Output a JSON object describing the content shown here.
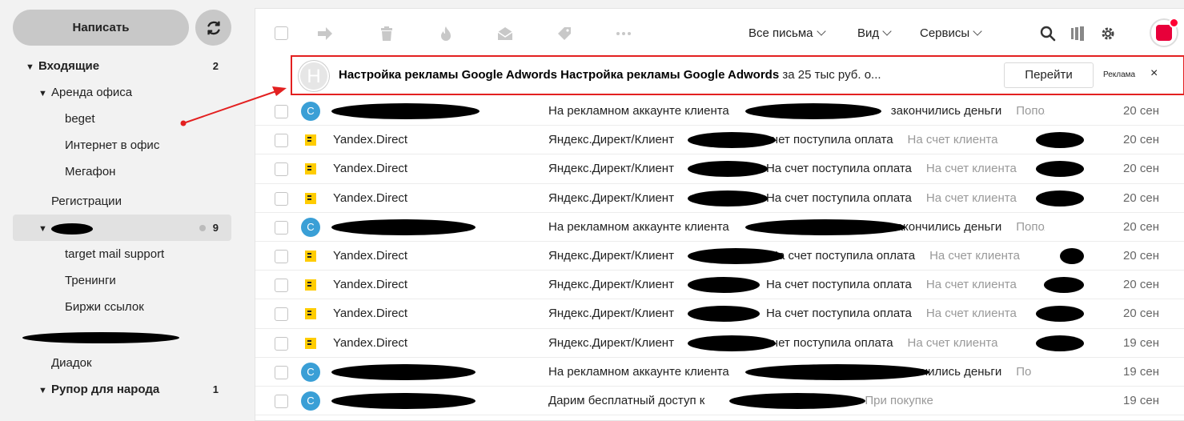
{
  "sidebar": {
    "compose_label": "Написать",
    "folders": [
      {
        "label": "Входящие",
        "count": "2"
      },
      {
        "label": "Аренда офиса"
      },
      {
        "label": "beget"
      },
      {
        "label": "Интернет в офис"
      },
      {
        "label": "Мегафон"
      },
      {
        "label": "Регистрации"
      },
      {
        "label": "",
        "count": "9"
      },
      {
        "label": "target mail support"
      },
      {
        "label": "Тренинги"
      },
      {
        "label": "Биржи ссылок"
      },
      {
        "label": ""
      },
      {
        "label": "Диадок"
      },
      {
        "label": "Рупор для народа",
        "count": "1"
      }
    ]
  },
  "toolbar": {
    "all_mail": "Все письма",
    "view": "Вид",
    "services": "Сервисы"
  },
  "ad": {
    "avatar_letter": "Н",
    "title_bold": "Настройка рекламы Google Adwords Настройка рекламы Google Adwords",
    "title_rest": "за 25 тыс руб. о...",
    "go_label": "Перейти",
    "ad_label": "Реклама",
    "close": "×"
  },
  "emails": [
    {
      "avatar": "С",
      "type": "c",
      "from": "",
      "subject": "На рекламном аккаунте клиента",
      "subject_end": "закончились деньги",
      "preview": "Попол...",
      "date": "20 сен"
    },
    {
      "avatar": "",
      "type": "y",
      "from": "Yandex.Direct",
      "subject": "Яндекс.Директ/Клиент",
      "subject_end": "счет поступила оплата",
      "preview": "На счет клиента",
      "date": "20 сен"
    },
    {
      "avatar": "",
      "type": "y",
      "from": "Yandex.Direct",
      "subject": "Яндекс.Директ/Клиент",
      "subject_end": "На счет поступила оплата",
      "preview": "На счет клиента",
      "date": "20 сен"
    },
    {
      "avatar": "",
      "type": "y",
      "from": "Yandex.Direct",
      "subject": "Яндекс.Директ/Клиент",
      "subject_end": "На счет поступила оплата",
      "preview": "На счет клиента",
      "date": "20 сен"
    },
    {
      "avatar": "С",
      "type": "c",
      "from": "",
      "subject": "На рекламном аккаунте клиента",
      "subject_end": "закончились деньги",
      "preview": "Попол...",
      "date": "20 сен"
    },
    {
      "avatar": "",
      "type": "y",
      "from": "Yandex.Direct",
      "subject": "Яндекс.Директ/Клиент",
      "subject_end": "/На счет поступила оплата",
      "preview": "На счет клиента",
      "date": "20 сен"
    },
    {
      "avatar": "",
      "type": "y",
      "from": "Yandex.Direct",
      "subject": "Яндекс.Директ/Клиент",
      "subject_end": "На счет поступила оплата",
      "preview": "На счет клиента",
      "date": "20 сен"
    },
    {
      "avatar": "",
      "type": "y",
      "from": "Yandex.Direct",
      "subject": "Яндекс.Директ/Клиент",
      "subject_end": "На счет поступила оплата",
      "preview": "На счет клиента",
      "date": "20 сен"
    },
    {
      "avatar": "",
      "type": "y",
      "from": "Yandex.Direct",
      "subject": "Яндекс.Директ/Клиент",
      "subject_end": "счет поступила оплата",
      "preview": "На счет клиента",
      "date": "19 сен"
    },
    {
      "avatar": "С",
      "type": "c",
      "from": "",
      "subject": "На рекламном аккаунте клиента",
      "subject_end": "закончились деньги",
      "preview": "По",
      "date": "19 сен"
    },
    {
      "avatar": "С",
      "type": "c",
      "from": "",
      "subject": "Дарим бесплатный доступ к",
      "subject_end": "",
      "preview": "При покупке",
      "date": "19 сен"
    }
  ],
  "colors": {
    "accent_red": "#e32020",
    "avatar_blue": "#3a9fd6",
    "yandex_yellow": "#ffcc00"
  }
}
